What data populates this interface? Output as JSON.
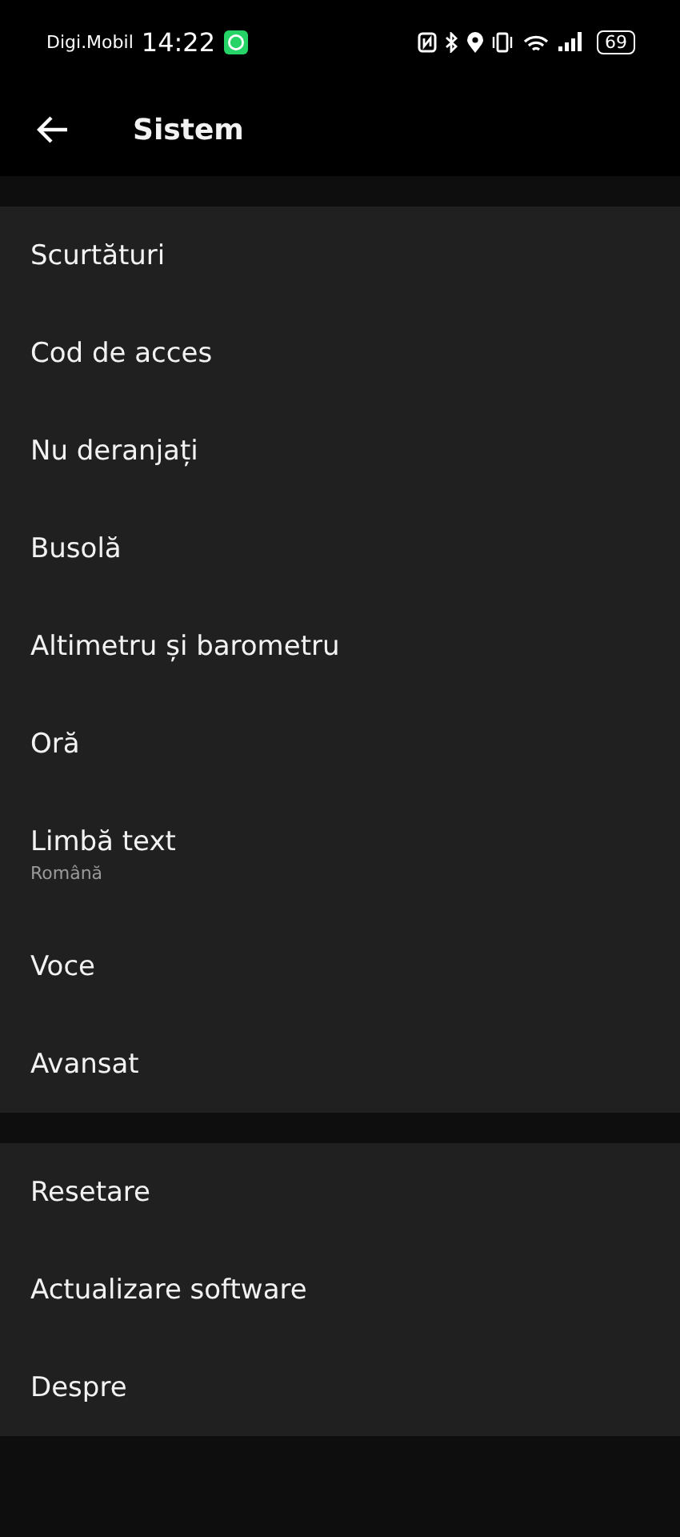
{
  "status_bar": {
    "carrier": "Digi.Mobil",
    "time": "14:22",
    "battery": "69"
  },
  "header": {
    "title": "Sistem"
  },
  "groups": [
    {
      "items": [
        {
          "label": "Scurtături"
        },
        {
          "label": "Cod de acces"
        },
        {
          "label": "Nu deranjați"
        },
        {
          "label": "Busolă"
        },
        {
          "label": "Altimetru și barometru"
        },
        {
          "label": "Oră"
        },
        {
          "label": "Limbă text",
          "value": "Română"
        },
        {
          "label": "Voce"
        },
        {
          "label": "Avansat"
        }
      ]
    },
    {
      "items": [
        {
          "label": "Resetare"
        },
        {
          "label": "Actualizare software"
        },
        {
          "label": "Despre"
        }
      ]
    }
  ]
}
